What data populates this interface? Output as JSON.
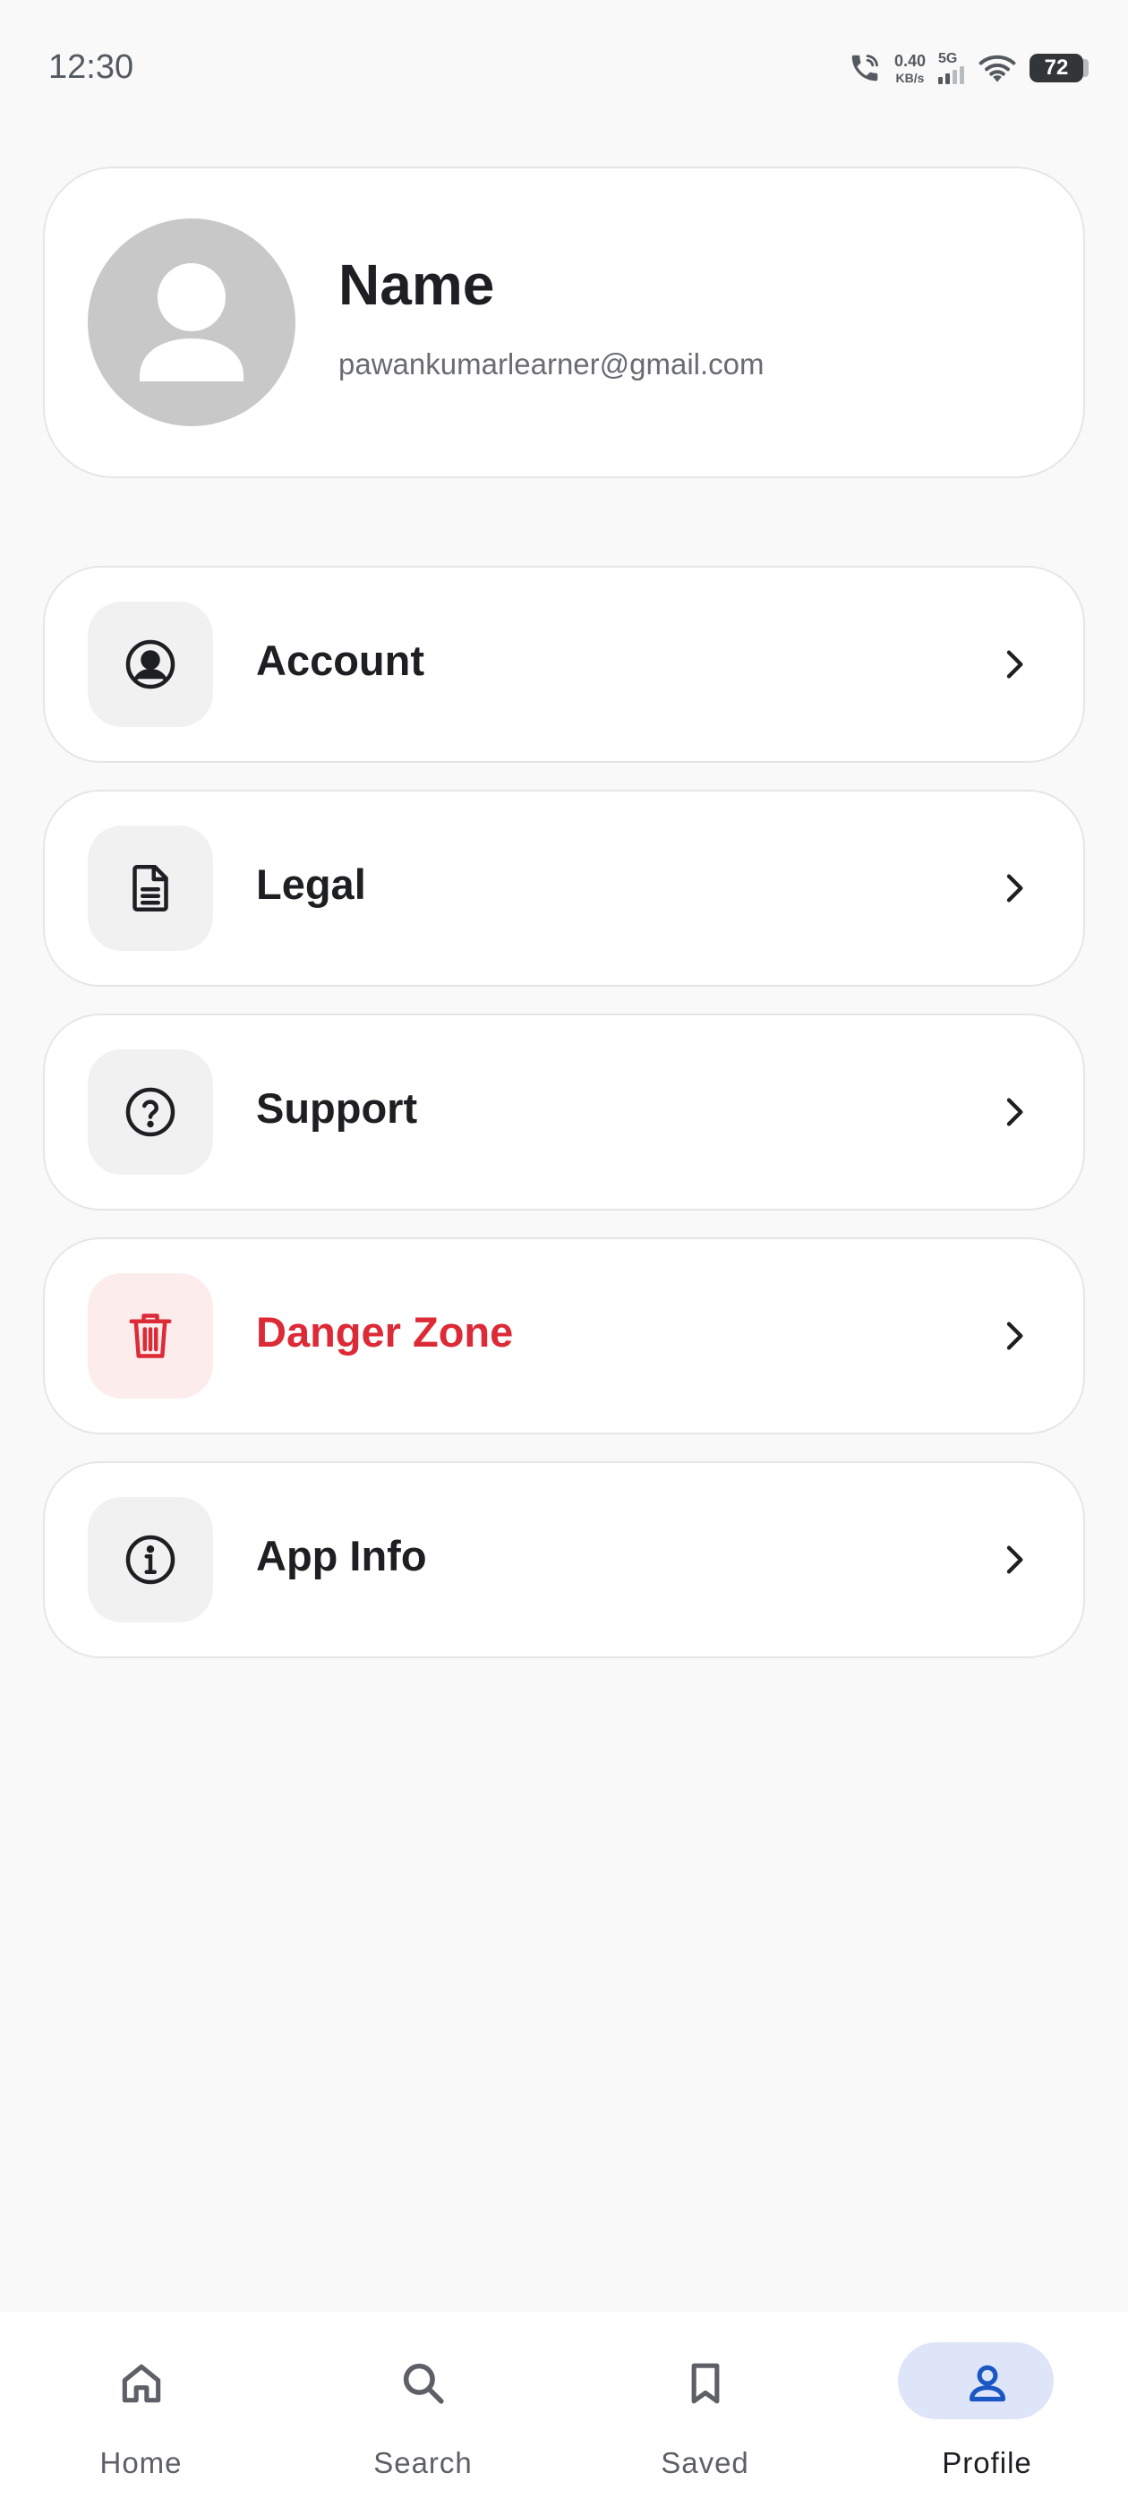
{
  "status_bar": {
    "time": "12:30",
    "net_speed_value": "0.40",
    "net_speed_unit": "KB/s",
    "network_type": "5G",
    "battery_level": "72"
  },
  "profile": {
    "name": "Name",
    "email": "pawankumarlearner@gmail.com"
  },
  "menu": {
    "items": [
      {
        "label": "Account",
        "icon": "user-circle-icon"
      },
      {
        "label": "Legal",
        "icon": "document-icon"
      },
      {
        "label": "Support",
        "icon": "help-circle-icon"
      },
      {
        "label": "Danger Zone",
        "icon": "trash-icon",
        "color": "#dc2a36"
      },
      {
        "label": "App Info",
        "icon": "info-circle-icon"
      }
    ]
  },
  "bottom_nav": {
    "items": [
      {
        "label": "Home",
        "icon": "home-icon"
      },
      {
        "label": "Search",
        "icon": "search-icon"
      },
      {
        "label": "Saved",
        "icon": "bookmark-icon"
      },
      {
        "label": "Profile",
        "icon": "person-icon",
        "active": true
      }
    ],
    "active_color": "#1a56c4",
    "active_pill_color": "#dfe5f8"
  }
}
